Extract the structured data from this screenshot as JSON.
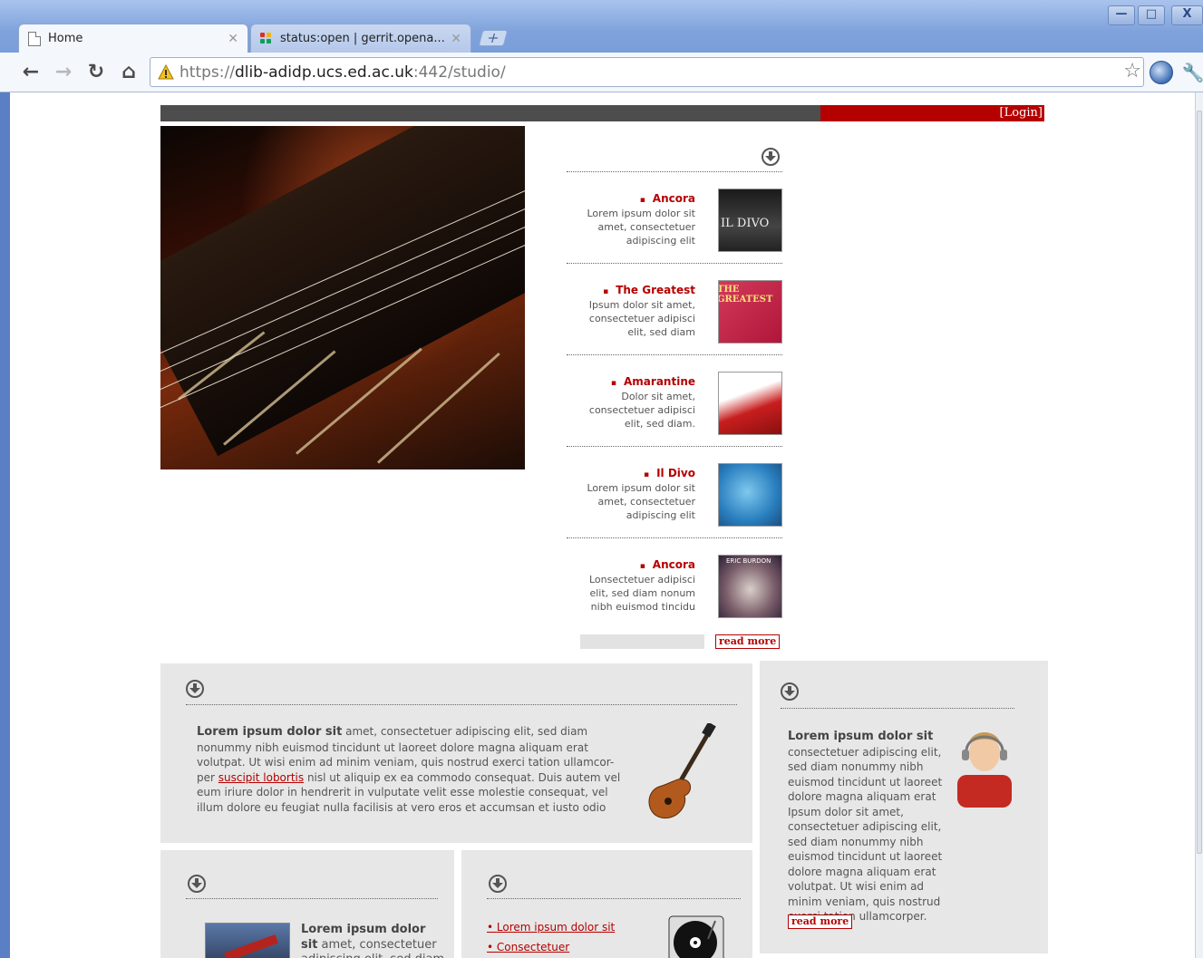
{
  "browser": {
    "tabs": [
      {
        "label": "Home",
        "active": true
      },
      {
        "label": "status:open | gerrit.opena...",
        "active": false
      }
    ],
    "new_tab": "+",
    "window_controls": {
      "minimize": "—",
      "maximize": "□",
      "close": "X"
    },
    "url": {
      "scheme": "https://",
      "host": "dlib-adidp.ucs.ed.ac.uk",
      "path": ":442/studio/"
    },
    "icons": [
      "back-icon",
      "forward-icon",
      "reload-icon",
      "home-icon",
      "star-icon",
      "extension-icon",
      "wrench-icon"
    ]
  },
  "page": {
    "login_link": "[Login]",
    "colors": {
      "accent_red": "#b50000",
      "bar_gray": "#4d4d4d",
      "panel_bg": "#e7e7e7"
    },
    "albums": [
      {
        "title": "Ancora",
        "desc": "Lorem ipsum dolor sit amet, consectetuer adipiscing elit",
        "cover_text": "IL DIVO"
      },
      {
        "title": "The Greatest",
        "desc": "Ipsum dolor sit amet, consectetuer adipisci elit, sed diam",
        "cover_text": "THE GREATEST"
      },
      {
        "title": "Amarantine",
        "desc": "Dolor sit amet, consectetuer adipisci elit, sed diam.",
        "cover_text": ""
      },
      {
        "title": "Il Divo",
        "desc": "Lorem ipsum dolor sit amet, consectetuer adipiscing elit",
        "cover_text": ""
      },
      {
        "title": "Ancora",
        "desc": "Lonsectetuer adipisci elit, sed diam nonum nibh euismod tincidu",
        "cover_text": "ERIC BURDON"
      }
    ],
    "albums_read_more": "read more",
    "feature_panel": {
      "bold": "Lorem ipsum dolor sit",
      "text_1": " amet, consectetuer adipiscing elit, sed diam nonummy nibh euismod tincidunt ut laoreet dolore magna aliquam erat volutpat. Ut wisi enim ad minim veniam, quis nostrud exerci tation ullamcor-per ",
      "link": "suscipit lobortis",
      "text_2": " nisl ut aliquip ex ea commodo consequat. Duis autem vel eum iriure dolor in hendrerit in vulputate velit esse molestie consequat, vel illum dolore eu feugiat nulla facilisis at vero eros et accumsan et iusto odio"
    },
    "side_panel": {
      "bold": "Lorem ipsum dolor sit",
      "text": "consectetuer adipiscing elit, sed diam nonummy nibh euismod tincidunt ut laoreet dolore magna aliquam erat Ipsum dolor sit amet, consectetuer adipiscing elit, sed diam nonummy nibh euismod tincidunt ut laoreet dolore magna aliquam erat volutpat. Ut wisi enim ad minim veniam, quis nostrud exerci tation ullamcorper.",
      "read_more": "read more"
    },
    "bottom_left": {
      "bold": "Lorem ipsum dolor sit",
      "text": " amet, consectetuer adipiscing elit, sed diam"
    },
    "bottom_mid": {
      "links": [
        "Lorem ipsum dolor sit",
        "Consectetuer"
      ]
    }
  }
}
